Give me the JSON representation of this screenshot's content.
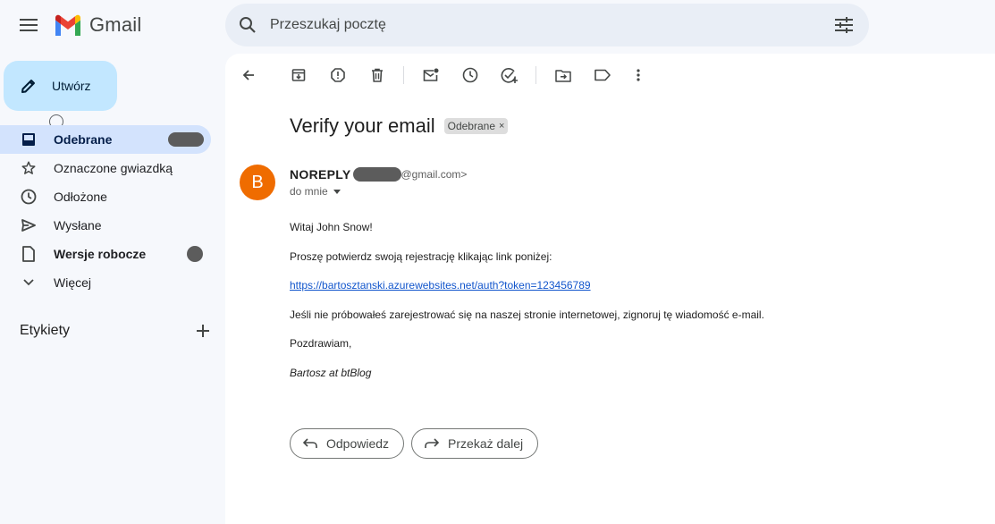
{
  "app": {
    "name": "Gmail"
  },
  "search": {
    "placeholder": "Przeszukaj pocztę"
  },
  "sidebar": {
    "compose_label": "Utwórz",
    "items": [
      {
        "label": "Odebrane",
        "icon": "inbox-icon",
        "active": true
      },
      {
        "label": "Oznaczone gwiazdką",
        "icon": "star-icon"
      },
      {
        "label": "Odłożone",
        "icon": "clock-icon"
      },
      {
        "label": "Wysłane",
        "icon": "send-icon"
      },
      {
        "label": "Wersje robocze",
        "icon": "draft-icon",
        "bold": true
      },
      {
        "label": "Więcej",
        "icon": "chevron-down-icon"
      }
    ],
    "labels_heading": "Etykiety"
  },
  "email": {
    "subject": "Verify your email",
    "label_chip": "Odebrane",
    "chip_close": "×",
    "avatar_letter": "B",
    "sender_name": "NOREPLY",
    "sender_email_suffix": "@gmail.com>",
    "to": "do mnie",
    "body": {
      "greeting": "Witaj John Snow!",
      "line1": "Proszę potwierdz swoją rejestrację klikając link poniżej:",
      "link": "https://bartosztanski.azurewebsites.net/auth?token=123456789",
      "line2": "Jeśli nie próbowałeś zarejestrować się na naszej stronie internetowej, zignoruj tę wiadomość e-mail.",
      "closing": "Pozdrawiam,",
      "signature": "Bartosz at btBlog"
    },
    "reply_label": "Odpowiedz",
    "forward_label": "Przekaż dalej"
  },
  "colors": {
    "background": "#f6f8fc",
    "compose": "#c2e7ff",
    "active_nav": "#d3e3fd",
    "avatar": "#ef6c00",
    "link": "#1155cc"
  }
}
